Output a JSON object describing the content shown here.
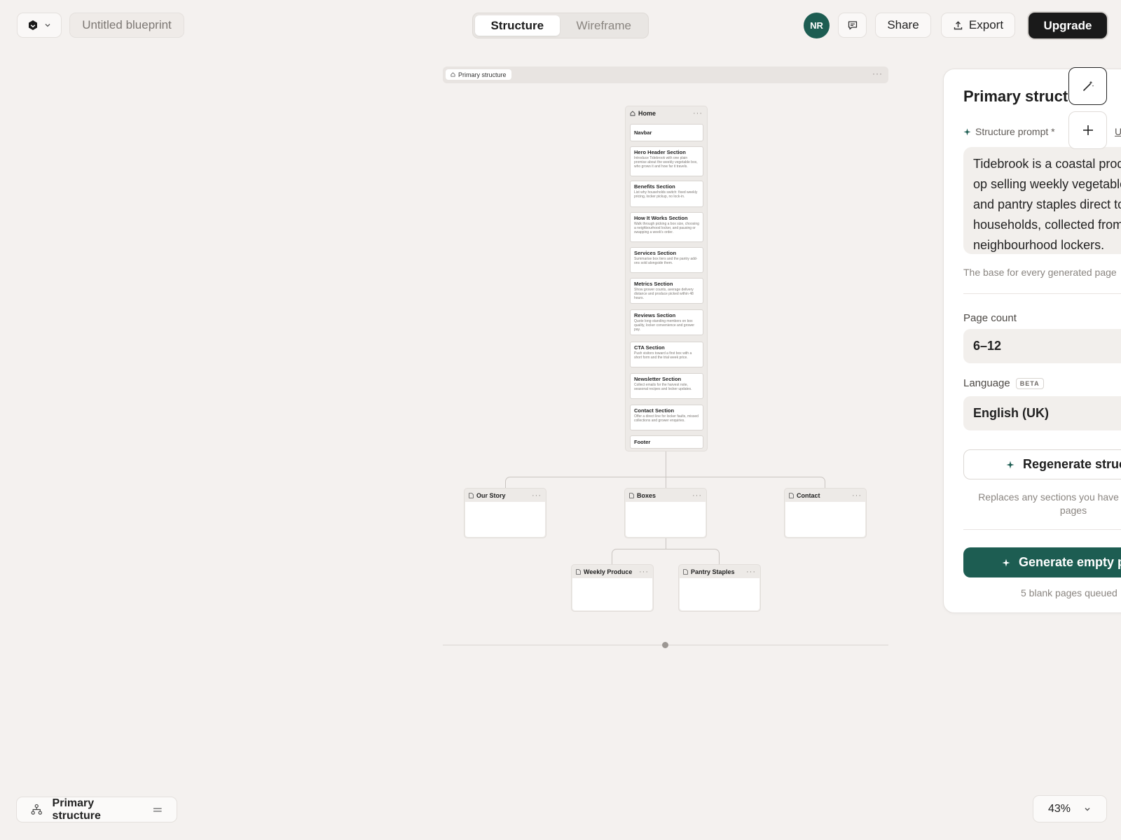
{
  "topbar": {
    "project_title": "Untitled blueprint",
    "view_tabs": [
      "Structure",
      "Wireframe"
    ],
    "active_tab": "Structure",
    "avatar_initials": "NR",
    "share_label": "Share",
    "export_label": "Export",
    "upgrade_label": "Upgrade"
  },
  "canvas": {
    "frame_label": "Primary structure",
    "home": {
      "title": "Home",
      "sections": [
        {
          "title": "Navbar",
          "desc": ""
        },
        {
          "title": "Hero Header Section",
          "desc": "Introduce Tidebrook with one plain promise about the weekly vegetable box, who grows it and how far it travels."
        },
        {
          "title": "Benefits Section",
          "desc": "List why households switch: fixed weekly pricing, locker pickup, no lock-in."
        },
        {
          "title": "How It Works Section",
          "desc": "Walk through picking a box size, choosing a neighbourhood locker, and pausing or swapping a week's order."
        },
        {
          "title": "Services Section",
          "desc": "Summarise box tiers and the pantry add-ons sold alongside them."
        },
        {
          "title": "Metrics Section",
          "desc": "Show grower counts, average delivery distance and produce picked within 48 hours."
        },
        {
          "title": "Reviews Section",
          "desc": "Quote long-standing members on box quality, locker convenience and grower pay."
        },
        {
          "title": "CTA Section",
          "desc": "Push visitors toward a first box with a short form and the trial week price."
        },
        {
          "title": "Newsletter Section",
          "desc": "Collect emails for the harvest note, seasonal recipes and locker updates."
        },
        {
          "title": "Contact Section",
          "desc": "Offer a direct line for locker faults, missed collections and grower enquiries."
        },
        {
          "title": "Footer",
          "desc": ""
        }
      ]
    },
    "pages": {
      "our_story": "Our Story",
      "boxes": "Boxes",
      "contact": "Contact",
      "weekly_produce": "Weekly Produce",
      "pantry_staples": "Pantry Staples"
    }
  },
  "panel": {
    "title": "Primary structure",
    "prompt_label": "Structure prompt *",
    "prompt_link": "U",
    "prompt_lines": [
      "Tidebrook is a coastal produce co-",
      "op selling weekly vegetable boxes",
      "and pantry staples direct to",
      "households, collected from",
      "neighbourhood lockers."
    ],
    "prompt_hint": "The base for every generated page",
    "page_count_label": "Page count",
    "page_count_value": "6–12",
    "language_label": "Language",
    "language_badge": "BETA",
    "language_value": "English (UK)",
    "regenerate_label": "Regenerate structure",
    "regenerate_note": "Replaces any sections you have on existing pages",
    "generate_label": "Generate empty pages",
    "queued_note": "5 blank pages queued"
  },
  "bottom": {
    "structure_label": "Primary structure",
    "zoom": "43%"
  },
  "colors": {
    "background": "#f4f1ef",
    "accent": "#1d5d52",
    "upgrade": "#1a1a1a"
  }
}
